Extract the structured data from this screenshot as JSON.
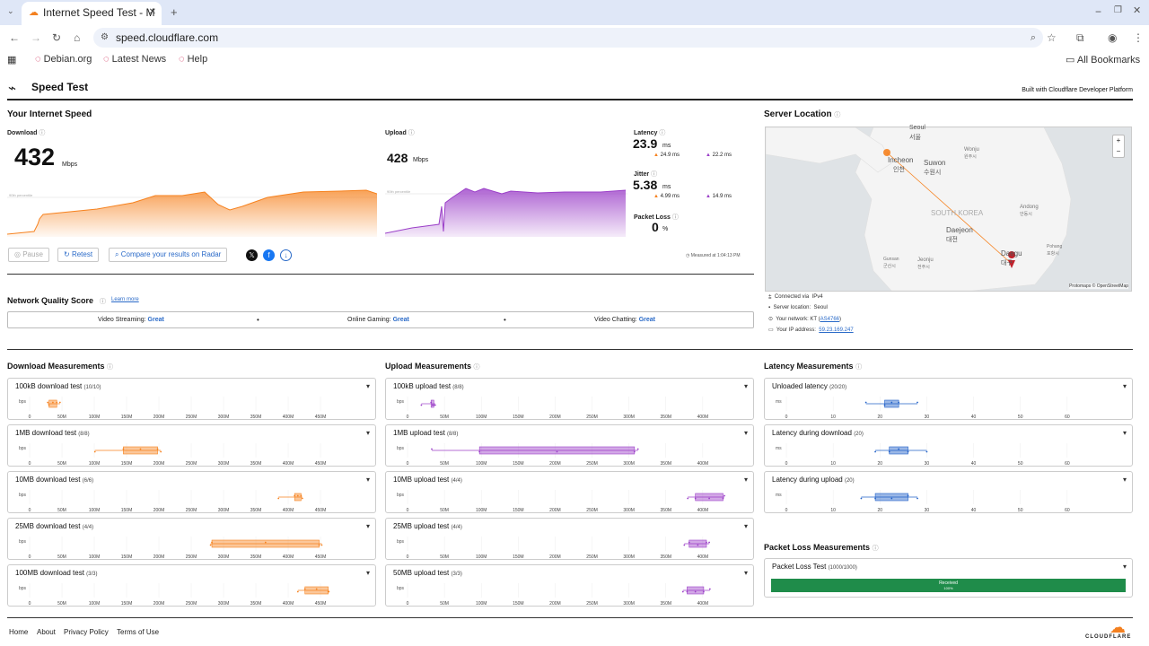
{
  "browser": {
    "tab_title": "Internet Speed Test - M",
    "url": "speed.cloudflare.com",
    "bookmarks": [
      "Debian.org",
      "Latest News",
      "Help"
    ],
    "all_bookmarks": "All Bookmarks"
  },
  "header": {
    "title": "Speed Test",
    "built_with": "Built with Cloudflare Developer Platform"
  },
  "speed": {
    "section_title": "Your Internet Speed",
    "download_label": "Download",
    "download_value": "432",
    "download_unit": "Mbps",
    "upload_label": "Upload",
    "upload_value": "428",
    "upload_unit": "Mbps",
    "percentile_label": "90th percentile",
    "latency_label": "Latency",
    "latency_value": "23.9",
    "latency_unit": "ms",
    "latency_down": "24.9 ms",
    "latency_up": "22.2 ms",
    "jitter_label": "Jitter",
    "jitter_value": "5.38",
    "jitter_unit": "ms",
    "jitter_down": "4.99 ms",
    "jitter_up": "14.9 ms",
    "packet_loss_label": "Packet Loss",
    "packet_loss_value": "0",
    "packet_loss_unit": "%",
    "measured_at": "Measured at 1:04:13 PM",
    "pause": "Pause",
    "retest": "Retest",
    "compare": "Compare your results on Radar"
  },
  "quality": {
    "title": "Network Quality Score",
    "learn_more": "Learn more",
    "items": [
      {
        "label": "Video Streaming:",
        "value": "Great"
      },
      {
        "label": "Online Gaming:",
        "value": "Great"
      },
      {
        "label": "Video Chatting:",
        "value": "Great"
      }
    ]
  },
  "server": {
    "title": "Server Location",
    "map_labels": [
      "Seoul",
      "서울",
      "Incheon",
      "인천",
      "Suwon",
      "수원시",
      "Wonju",
      "원주시",
      "SOUTH KOREA",
      "Andong",
      "안동시",
      "Daejeon",
      "대전",
      "Daegu",
      "대구",
      "Jeonju",
      "전주시",
      "Gunsan",
      "군산시",
      "Pohang",
      "포항시"
    ],
    "attribution": "Protomaps © OpenStreetMap",
    "zoom_in": "+",
    "zoom_out": "−",
    "connected_via_label": "Connected via",
    "connected_via": "IPv4",
    "server_location_label": "Server location:",
    "server_location": "Seoul",
    "network_label": "Your network:",
    "network_name": "KT",
    "network_as": "AS4766",
    "ip_label": "Your IP address:",
    "ip": "59.23.169.247"
  },
  "download_measurements": {
    "title": "Download Measurements",
    "cards": [
      {
        "title": "100kB download test",
        "count": "(10/10)",
        "box": [
          30,
          42
        ],
        "whisker": [
          28,
          47
        ]
      },
      {
        "title": "1MB download test",
        "count": "(8/8)",
        "box": [
          145,
          198
        ],
        "whisker": [
          101,
          203
        ]
      },
      {
        "title": "10MB download test",
        "count": "(6/6)",
        "box": [
          410,
          420
        ],
        "whisker": [
          385,
          422
        ]
      },
      {
        "title": "25MB download test",
        "count": "(4/4)",
        "box": [
          282,
          448
        ],
        "whisker": [
          280,
          452
        ]
      },
      {
        "title": "100MB download test",
        "count": "(3/3)",
        "box": [
          426,
          462
        ],
        "whisker": [
          415,
          463
        ]
      }
    ],
    "axis_unit": "bps",
    "ticks": [
      "0",
      "50M",
      "100M",
      "150M",
      "200M",
      "250M",
      "300M",
      "350M",
      "400M",
      "450M"
    ]
  },
  "upload_measurements": {
    "title": "Upload Measurements",
    "cards": [
      {
        "title": "100kB upload test",
        "count": "(8/8)",
        "box": [
          34,
          38
        ],
        "whisker": [
          20,
          40
        ]
      },
      {
        "title": "1MB upload test",
        "count": "(8/8)",
        "box": [
          104,
          328
        ],
        "whisker": [
          35,
          333
        ]
      },
      {
        "title": "10MB upload test",
        "count": "(4/4)",
        "box": [
          416,
          456
        ],
        "whisker": [
          405,
          458
        ]
      },
      {
        "title": "25MB upload test",
        "count": "(4/4)",
        "box": [
          407,
          432
        ],
        "whisker": [
          400,
          436
        ]
      },
      {
        "title": "50MB upload test",
        "count": "(3/3)",
        "box": [
          404,
          428
        ],
        "whisker": [
          398,
          437
        ]
      }
    ],
    "axis_unit": "bps",
    "ticks": [
      "0",
      "50M",
      "100M",
      "150M",
      "200M",
      "250M",
      "300M",
      "350M",
      "400M"
    ]
  },
  "latency_measurements": {
    "title": "Latency Measurements",
    "cards": [
      {
        "title": "Unloaded latency",
        "count": "(20/20)",
        "box": [
          21,
          24
        ],
        "whisker": [
          17,
          28
        ]
      },
      {
        "title": "Latency during download",
        "count": "(20)",
        "box": [
          22,
          26
        ],
        "whisker": [
          19,
          30
        ]
      },
      {
        "title": "Latency during upload",
        "count": "(20)",
        "box": [
          19,
          26
        ],
        "whisker": [
          16,
          28
        ]
      }
    ],
    "axis_unit": "ms",
    "ticks": [
      "0",
      "10",
      "20",
      "30",
      "40",
      "50",
      "60"
    ]
  },
  "packet_loss": {
    "title": "Packet Loss Measurements",
    "card_title": "Packet Loss Test",
    "count": "(1000/1000)",
    "bar_label": "Received",
    "bar_pct": "100%",
    "received_fraction": 1.0
  },
  "footer": {
    "links": [
      "Home",
      "About",
      "Privacy Policy",
      "Terms of Use"
    ],
    "logo": "CLOUDFLARE"
  },
  "colors": {
    "download": "#f6821f",
    "upload": "#9b3fc8",
    "latency": "#2060c8",
    "great": "#2a6ac8",
    "packet": "#1f8c4a"
  }
}
